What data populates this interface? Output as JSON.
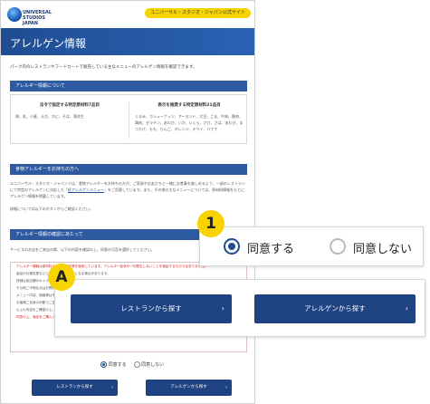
{
  "header": {
    "logo_text": "UNIVERSAL STUDIOS JAPAN",
    "official_link": "ユニバーサル・スタジオ・ジャパン公式サイト"
  },
  "hero": {
    "title": "アレルゲン情報"
  },
  "intro": "パーク内のレストランやフードカートで販売している主なメニューのアレルゲン情報を確認できます。",
  "allergy_section": {
    "title": "アレルギー情報について",
    "left_heading": "法令で指定する特定原材料7品目",
    "left_items": "卵、乳、小麦、えび、かに、そば、落花生",
    "right_heading": "表示を推奨する特定原材料21品目",
    "right_items": "くるみ、カシューナッツ、アーモンド、大豆、ごま、牛肉、豚肉、鶏肉、ゼラチン、あわび、いか、いくら、さけ、さば、あわび、まつたけ、もも、りんご、オレンジ、キウイ、バナナ"
  },
  "food_section": {
    "title": "食物アレルギーをお持ちの方へ",
    "para1_a": "ユニバーサル・スタジオ・ジャパンでは、食物アレルギーをお持ちの方が、ご家族やお友だちと一緒にお食事を楽しめるよう、一部のレストランにて特定のアレルゲンに対応した「",
    "para1_link": "低アレルゲンメニュー",
    "para1_b": "」をご用意しています。また、その他の主なメニューについては、原材料情報をもとにアレルゲン情報を掲載しています。",
    "para2": "詳細については以下のボタンからご確認ください。"
  },
  "confirm_section": {
    "title": "アレルギー情報の確認にあたって",
    "lead": "サービスのお店をご来店の際、以下の内容を確認の上、同意の可否を選択してください。",
    "caution_lines": [
      "アレルギー情報は原材料の特定原材料等を使用しています。アレルギー症状が一切発生しないことを保証するものではありません。",
      "製品の仕様変更などにより、内容が変更になる場合があります。",
      "詳細は各店舗のキャストにお尋ねください。",
      "その他ご不明な点はお問い合わせください。",
      "メニュー内容、価格等は予告なく変更となる場合があります。",
      "お客様ご自身の判断でご注文ください。",
      "以上の内容をご確認の上、ご同意いただける方のみ次にお進みください。"
    ],
    "caution_emph": "同意の上、商品をご購入ください。"
  },
  "consent": {
    "agree_label": "同意する",
    "disagree_label": "同意しない",
    "selected": "agree"
  },
  "buttons": {
    "restaurant": "レストランから探す",
    "allergen": "アレルゲンから探す",
    "arrow": "›"
  },
  "markers": {
    "one": "1",
    "a": "A"
  },
  "colors": {
    "brand_blue": "#1f4282",
    "accent_yellow": "#f7d300"
  }
}
